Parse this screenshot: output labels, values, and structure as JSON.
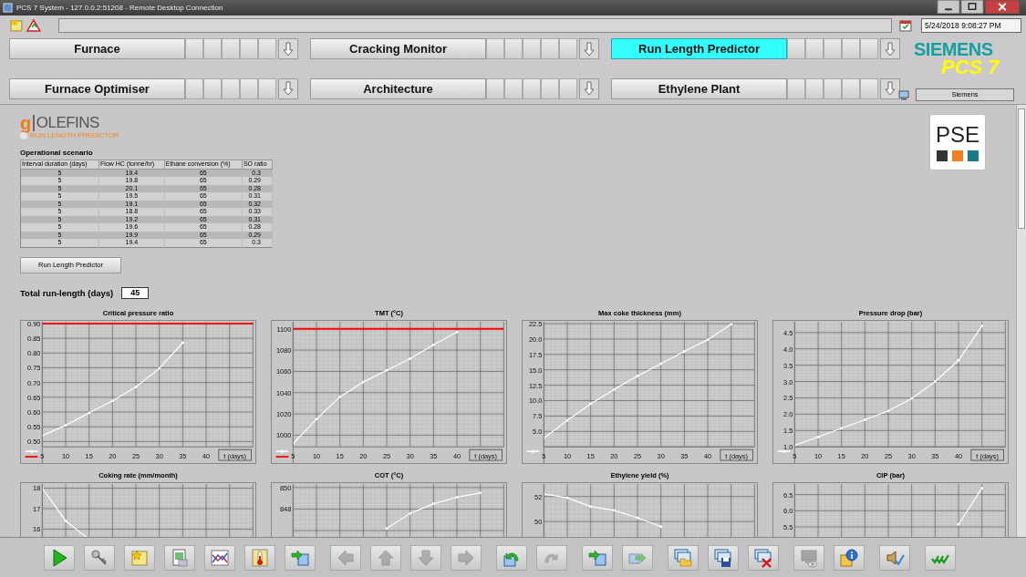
{
  "window": {
    "title": "PCS 7 System - 127.0.0.2:51208 - Remote Desktop Connection"
  },
  "header": {
    "datetime": "5/24/2018 9:08:27 PM",
    "brand": "SIEMENS",
    "product": "PCS 7",
    "user": "Siemens"
  },
  "nav": [
    {
      "label": "Furnace",
      "selected": false
    },
    {
      "label": "Cracking Monitor",
      "selected": false
    },
    {
      "label": "Run Length Predictor",
      "selected": true
    },
    {
      "label": "Furnace Optimiser",
      "selected": false
    },
    {
      "label": "Architecture",
      "selected": false
    },
    {
      "label": "Ethylene Plant",
      "selected": false
    }
  ],
  "app": {
    "logo_mark": "g",
    "logo_name": "OLEFINS",
    "logo_subtitle": "RUN LENGTH PREDICTOR",
    "partner_logo": "PSE"
  },
  "scenario": {
    "title": "Operational scenario",
    "columns": [
      "Interval duration (days)",
      "Flow HC (tonne/hr)",
      "Ethane conversion (%)",
      "SO ratio"
    ],
    "rows": [
      [
        "5",
        "19.4",
        "65",
        "0.3"
      ],
      [
        "5",
        "19.8",
        "65",
        "0.29"
      ],
      [
        "5",
        "20.1",
        "65",
        "0.28"
      ],
      [
        "5",
        "19.5",
        "65",
        "0.31"
      ],
      [
        "5",
        "19.1",
        "65",
        "0.32"
      ],
      [
        "5",
        "18.8",
        "65",
        "0.33"
      ],
      [
        "5",
        "19.2",
        "65",
        "0.31"
      ],
      [
        "5",
        "19.6",
        "65",
        "0.28"
      ],
      [
        "5",
        "19.9",
        "65",
        "0.29"
      ],
      [
        "5",
        "19.4",
        "65",
        "0.3"
      ]
    ]
  },
  "run_button": "Run Length Predictor",
  "total": {
    "label": "Total run-length (days)",
    "value": "45"
  },
  "charts": [
    {
      "chart_data": {
        "type": "line",
        "title": "Critical pressure ratio",
        "xlabel": "t (days)",
        "grid": true,
        "x": [
          5,
          10,
          15,
          20,
          25,
          30,
          35
        ],
        "xlim": [
          5,
          50
        ],
        "ylim": [
          0.482,
          0.906
        ],
        "xticks": [
          5,
          10,
          15,
          20,
          25,
          30,
          35,
          40
        ],
        "yticks": [
          {
            "value": 0.5,
            "label": "0.50"
          },
          {
            "value": 0.55,
            "label": "0.55"
          },
          {
            "value": 0.6,
            "label": "0.60"
          },
          {
            "value": 0.65,
            "label": "0.65"
          },
          {
            "value": 0.7,
            "label": "0.70"
          },
          {
            "value": 0.75,
            "label": "0.75"
          },
          {
            "value": 0.8,
            "label": "0.80"
          },
          {
            "value": 0.85,
            "label": "0.85"
          },
          {
            "value": 0.9,
            "label": "0.90"
          }
        ],
        "series": [
          {
            "color": "#ffffff",
            "marker": "square",
            "values": [
              0.52,
              0.555,
              0.597,
              0.638,
              0.685,
              0.748,
              0.835
            ]
          }
        ],
        "ref_lines": [
          {
            "axis": "y",
            "value": 0.9,
            "color": "#ff0000"
          }
        ]
      }
    },
    {
      "chart_data": {
        "type": "line",
        "title": "TMT (°C)",
        "xlabel": "t (days)",
        "grid": true,
        "x": [
          5,
          10,
          15,
          20,
          25,
          30,
          35,
          40
        ],
        "xlim": [
          5,
          50
        ],
        "ylim": [
          989,
          1106.7
        ],
        "xticks": [
          5,
          10,
          15,
          20,
          25,
          30,
          35,
          40
        ],
        "yticks": [
          1000,
          1020,
          1040,
          1060,
          1080,
          1100
        ],
        "series": [
          {
            "color": "#ffffff",
            "marker": "square",
            "values": [
              992,
              1015,
              1036,
              1050,
              1061,
              1072,
              1085,
              1097
            ]
          }
        ],
        "ref_lines": [
          {
            "axis": "y",
            "value": 1100,
            "color": "#ff0000"
          }
        ]
      }
    },
    {
      "chart_data": {
        "type": "line",
        "title": "Max coke thickness (mm)",
        "xlabel": "t (days)",
        "grid": true,
        "x": [
          5,
          10,
          15,
          20,
          25,
          30,
          35,
          40,
          45
        ],
        "xlim": [
          5,
          50
        ],
        "ylim": [
          2.5,
          22.8
        ],
        "xticks": [
          5,
          10,
          15,
          20,
          25,
          30,
          35,
          40
        ],
        "yticks": [
          {
            "value": 5,
            "label": "5.0"
          },
          {
            "value": 7.5,
            "label": "7.5"
          },
          {
            "value": 10,
            "label": "10.0"
          },
          {
            "value": 12.5,
            "label": "12.5"
          },
          {
            "value": 15,
            "label": "15.0"
          },
          {
            "value": 17.5,
            "label": "17.5"
          },
          {
            "value": 20,
            "label": "20.0"
          },
          {
            "value": 22.5,
            "label": "22.5"
          }
        ],
        "series": [
          {
            "color": "#ffffff",
            "marker": "square",
            "values": [
              3.9,
              6.8,
              9.5,
              11.8,
              14.0,
              16.0,
              18.0,
              19.9,
              22.4
            ]
          }
        ]
      }
    },
    {
      "chart_data": {
        "type": "line",
        "title": "Pressure drop (bar)",
        "xlabel": "t (days)",
        "grid": true,
        "x": [
          5,
          10,
          15,
          20,
          25,
          30,
          35,
          40,
          45
        ],
        "xlim": [
          5,
          50
        ],
        "ylim": [
          1.0,
          4.83
        ],
        "xticks": [
          5,
          10,
          15,
          20,
          25,
          30,
          35,
          40
        ],
        "yticks": [
          {
            "value": 1,
            "label": "1.0"
          },
          {
            "value": 1.5,
            "label": "1.5"
          },
          {
            "value": 2,
            "label": "2.0"
          },
          {
            "value": 2.5,
            "label": "2.5"
          },
          {
            "value": 3,
            "label": "3.0"
          },
          {
            "value": 3.5,
            "label": "3.5"
          },
          {
            "value": 4,
            "label": "4.0"
          },
          {
            "value": 4.5,
            "label": "4.5"
          }
        ],
        "series": [
          {
            "color": "#ffffff",
            "marker": "square",
            "values": [
              1.05,
              1.3,
              1.57,
              1.83,
              2.1,
              2.48,
              3.0,
              3.65,
              4.7
            ]
          }
        ]
      }
    },
    {
      "chart_data": {
        "type": "line",
        "title": "Coking rate (mm/month)",
        "grid": true,
        "x": [
          5,
          10,
          15
        ],
        "xlim": [
          5,
          50
        ],
        "ylim": [
          12.1,
          18.2
        ],
        "yticks": [
          16,
          17,
          18
        ],
        "series": [
          {
            "color": "#ffffff",
            "marker": "square",
            "values": [
              18.0,
              16.4,
              15.5
            ]
          }
        ]
      }
    },
    {
      "chart_data": {
        "type": "line",
        "title": "COT (°C)",
        "grid": true,
        "x": [
          25,
          30,
          35,
          40,
          45
        ],
        "xlim": [
          5,
          50
        ],
        "ylim": [
          838.7,
          850.33
        ],
        "yticks": [
          848,
          850
        ],
        "series": [
          {
            "color": "#ffffff",
            "marker": "square",
            "values": [
              846.2,
              847.6,
              848.5,
              849.1,
              849.5
            ]
          }
        ]
      }
    },
    {
      "chart_data": {
        "type": "line",
        "title": "Ethylene yield (%)",
        "grid": true,
        "x": [
          5,
          10,
          15,
          20,
          25,
          30
        ],
        "xlim": [
          5,
          50
        ],
        "ylim": [
          43,
          53
        ],
        "yticks": [
          50,
          52
        ],
        "series": [
          {
            "color": "#ffffff",
            "marker": "square",
            "values": [
              52.2,
              51.9,
              51.2,
              50.9,
              50.3,
              49.6
            ]
          }
        ]
      }
    },
    {
      "chart_data": {
        "type": "line",
        "title": "CIP (bar)",
        "grid": true,
        "x": [
          40,
          45
        ],
        "xlim": [
          5,
          50
        ],
        "ylim": [
          2.95,
          6.83
        ],
        "yticks": [
          {
            "value": 5.5,
            "label": "5.5"
          },
          {
            "value": 6,
            "label": "6.0"
          },
          {
            "value": 6.5,
            "label": "6.5"
          }
        ],
        "series": [
          {
            "color": "#ffffff",
            "marker": "square",
            "values": [
              5.58,
              6.7
            ]
          }
        ]
      }
    }
  ],
  "toolbar": [
    [
      {
        "kind": "play",
        "disabled": false
      },
      {
        "kind": "keys",
        "disabled": false
      },
      {
        "kind": "new-picture",
        "disabled": false
      },
      {
        "kind": "report",
        "disabled": false
      },
      {
        "kind": "trend",
        "disabled": false
      },
      {
        "kind": "thermometer",
        "disabled": false
      },
      {
        "kind": "transfer",
        "disabled": false
      }
    ],
    [
      {
        "kind": "left",
        "disabled": true
      },
      {
        "kind": "up",
        "disabled": true
      },
      {
        "kind": "down",
        "disabled": true
      },
      {
        "kind": "right",
        "disabled": true
      }
    ],
    [
      {
        "kind": "undo",
        "disabled": false
      },
      {
        "kind": "redo",
        "disabled": true
      }
    ],
    [
      {
        "kind": "import",
        "disabled": false
      },
      {
        "kind": "export",
        "disabled": true
      }
    ],
    [
      {
        "kind": "open",
        "disabled": false
      },
      {
        "kind": "save",
        "disabled": false
      },
      {
        "kind": "delete",
        "disabled": false
      }
    ],
    [
      {
        "kind": "monitor",
        "disabled": true
      },
      {
        "kind": "info",
        "disabled": false
      }
    ],
    [
      {
        "kind": "sound",
        "disabled": false
      }
    ],
    [
      {
        "kind": "acknowledge",
        "disabled": false
      }
    ]
  ]
}
